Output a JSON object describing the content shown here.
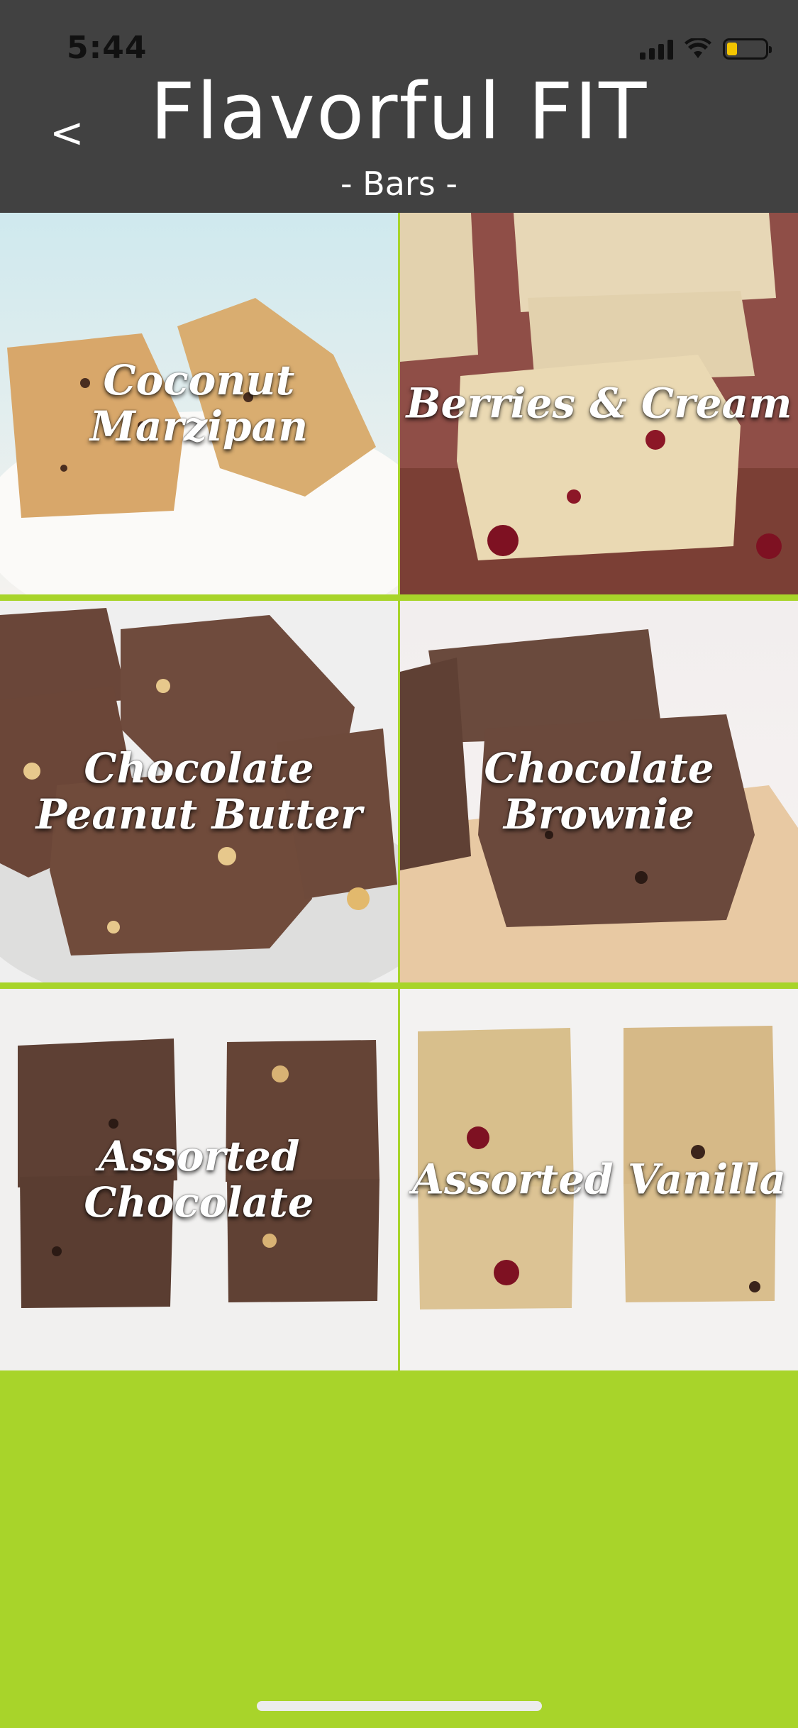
{
  "status": {
    "time": "5:44"
  },
  "header": {
    "back_label": "<",
    "title": "Flavorful FIT",
    "subtitle": "- Bars -"
  },
  "bars": [
    {
      "label": "Coconut Marzipan",
      "theme": "light"
    },
    {
      "label": "Berries & Cream",
      "theme": "berry"
    },
    {
      "label": "Chocolate\nPeanut Butter",
      "theme": "choc"
    },
    {
      "label": "Chocolate Brownie",
      "theme": "brownie"
    },
    {
      "label": "Assorted Chocolate",
      "theme": "assorted-choc"
    },
    {
      "label": "Assorted Vanilla",
      "theme": "assorted-vanilla"
    }
  ],
  "colors": {
    "header": "#414141",
    "accent": "#a8d42a"
  },
  "icons": {
    "back": "chevron-left-icon",
    "signal": "signal-icon",
    "wifi": "wifi-icon",
    "battery": "battery-icon"
  }
}
